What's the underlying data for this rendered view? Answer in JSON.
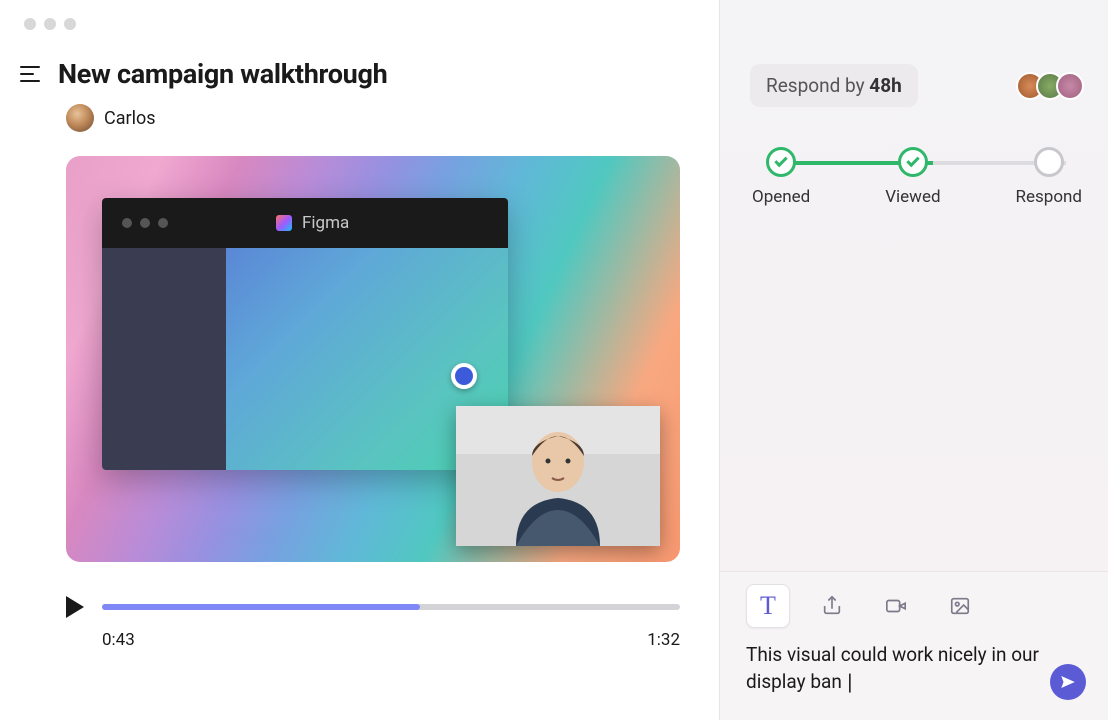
{
  "header": {
    "title": "New campaign walkthrough",
    "author": "Carlos"
  },
  "figma": {
    "app_name": "Figma"
  },
  "player": {
    "current_time": "0:43",
    "duration": "1:32",
    "progress_pct": 55
  },
  "respond": {
    "prefix": "Respond by ",
    "deadline": "48h"
  },
  "steps": {
    "opened": "Opened",
    "viewed": "Viewed",
    "respond": "Respond"
  },
  "compose": {
    "text": "This visual could work nicely in our display ban"
  }
}
